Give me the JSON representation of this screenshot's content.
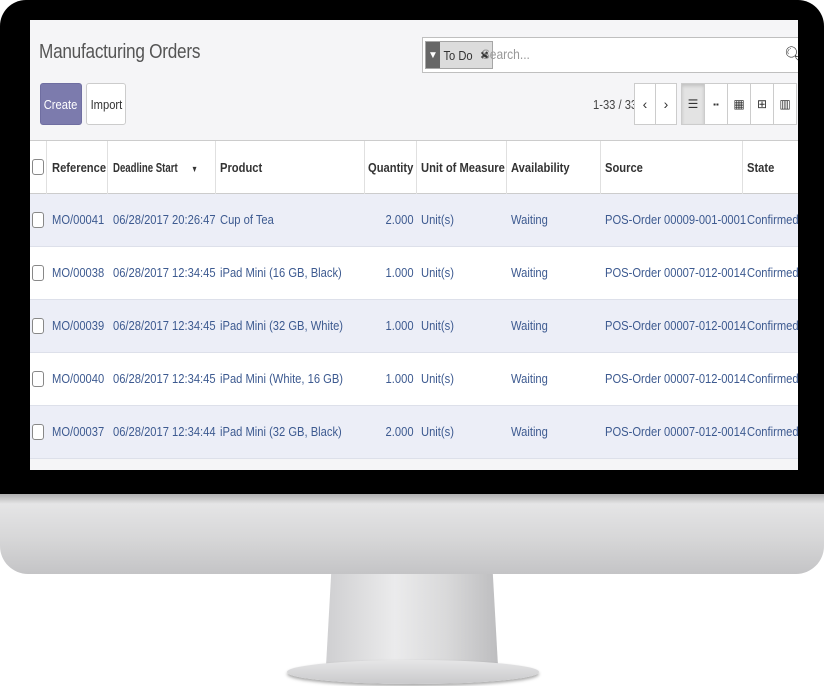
{
  "app": {
    "title": "Manufacturing Orders"
  },
  "search": {
    "facet_label": "To Do",
    "facet_remove": "✖",
    "placeholder": "Search...",
    "icon": "search-icon"
  },
  "buttons": {
    "create": "Create",
    "import": "Import"
  },
  "pager": {
    "text": "1-33 / 33",
    "prev": "‹",
    "next": "›"
  },
  "views": [
    {
      "name": "list",
      "icon": "☰",
      "active": true
    },
    {
      "name": "kanban",
      "icon": "▪▪"
    },
    {
      "name": "calendar",
      "icon": "▦"
    },
    {
      "name": "pivot",
      "icon": "⊞"
    },
    {
      "name": "graph",
      "icon": "▥"
    }
  ],
  "table": {
    "columns": [
      "Reference",
      "Deadline Start",
      "Product",
      "Quantity",
      "Unit of Measure",
      "Availability",
      "Source",
      "State"
    ],
    "sort_indicator": "▼",
    "rows": [
      {
        "reference": "MO/00041",
        "deadline": "06/28/2017 20:26:47",
        "product": "Cup of Tea",
        "quantity": "2.000",
        "uom": "Unit(s)",
        "availability": "Waiting",
        "source": "POS-Order 00009-001-0001",
        "state": "Confirmed"
      },
      {
        "reference": "MO/00038",
        "deadline": "06/28/2017 12:34:45",
        "product": "iPad Mini (16 GB, Black)",
        "quantity": "1.000",
        "uom": "Unit(s)",
        "availability": "Waiting",
        "source": "POS-Order 00007-012-0014",
        "state": "Confirmed"
      },
      {
        "reference": "MO/00039",
        "deadline": "06/28/2017 12:34:45",
        "product": "iPad Mini (32 GB, White)",
        "quantity": "1.000",
        "uom": "Unit(s)",
        "availability": "Waiting",
        "source": "POS-Order 00007-012-0014",
        "state": "Confirmed"
      },
      {
        "reference": "MO/00040",
        "deadline": "06/28/2017 12:34:45",
        "product": "iPad Mini (White, 16 GB)",
        "quantity": "1.000",
        "uom": "Unit(s)",
        "availability": "Waiting",
        "source": "POS-Order 00007-012-0014",
        "state": "Confirmed"
      },
      {
        "reference": "MO/00037",
        "deadline": "06/28/2017 12:34:44",
        "product": "iPad Mini (32 GB, Black)",
        "quantity": "2.000",
        "uom": "Unit(s)",
        "availability": "Waiting",
        "source": "POS-Order 00007-012-0014",
        "state": "Confirmed"
      }
    ]
  },
  "colors": {
    "primary": "#7c7bad",
    "link": "#3d5a90",
    "row_stripe": "#eceef7"
  }
}
